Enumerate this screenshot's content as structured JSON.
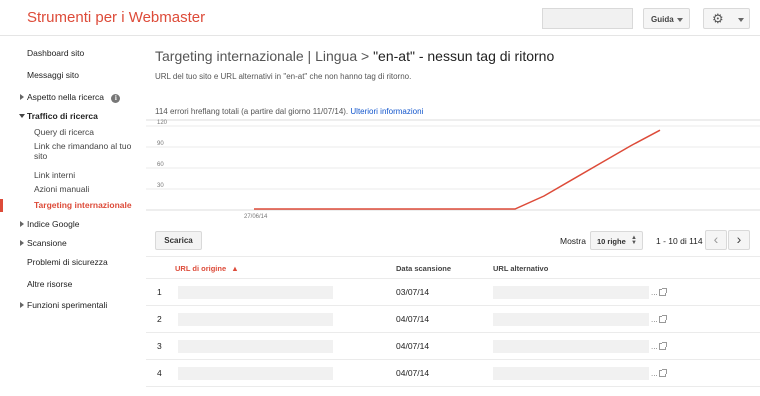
{
  "header": {
    "app_title": "Strumenti per i Webmaster",
    "help_label": "Guida",
    "search_value": ""
  },
  "sidebar": {
    "items": [
      {
        "label": "Dashboard sito"
      },
      {
        "label": "Messaggi sito"
      },
      {
        "label": "Aspetto nella ricerca"
      },
      {
        "label": "Traffico di ricerca"
      },
      {
        "label": "Query di ricerca"
      },
      {
        "label": "Link che rimandano al tuo"
      },
      {
        "label": "sito"
      },
      {
        "label": "Link interni"
      },
      {
        "label": "Azioni manuali"
      },
      {
        "label": "Targeting internazionale"
      },
      {
        "label": "Indice Google"
      },
      {
        "label": "Scansione"
      },
      {
        "label": "Problemi di sicurezza"
      },
      {
        "label": "Altre risorse"
      },
      {
        "label": "Funzioni sperimentali"
      }
    ]
  },
  "main": {
    "title_prefix": "Targeting internazionale | Lingua > ",
    "title_highlight": "\"en-at\" - nessun tag di ritorno",
    "subtitle": "URL del tuo sito e URL alternativi in \"en-at\" che non hanno tag di ritorno.",
    "error_summary": "114 errori hreflang totali (a partire dal giorno 11/07/14).",
    "more_info_link": "Ulteriori informazioni",
    "download_button": "Scarica",
    "show_label": "Mostra",
    "rows_select_value": "10 righe",
    "pager_text": "1 - 10 di 114",
    "prev_icon": "chevron-left",
    "next_icon": "chevron-right"
  },
  "chart_data": {
    "type": "line",
    "x": [
      "27/06/14",
      "",
      "",
      "",
      "",
      "",
      "",
      "",
      "",
      "",
      "",
      "",
      "",
      "",
      "11/07/14"
    ],
    "tick_labels_x": [
      "27/06/14"
    ],
    "yticks": [
      "120",
      "90",
      "60",
      "30"
    ],
    "ylim": [
      0,
      120
    ],
    "series": [
      {
        "values": [
          0,
          0,
          0,
          0,
          0,
          0,
          0,
          0,
          0,
          0,
          20,
          44,
          68,
          92,
          114
        ]
      }
    ],
    "line_color": "#dd4b39",
    "grid": true
  },
  "table": {
    "columns": [
      "URL di origine",
      "Data scansione",
      "URL alternativo"
    ],
    "sort_indicator": "▲",
    "rows": [
      {
        "num": "1",
        "date": "03/07/14",
        "dots": "..."
      },
      {
        "num": "2",
        "date": "04/07/14",
        "dots": "..."
      },
      {
        "num": "3",
        "date": "04/07/14",
        "dots": "..."
      },
      {
        "num": "4",
        "date": "04/07/14",
        "dots": "..."
      }
    ]
  }
}
